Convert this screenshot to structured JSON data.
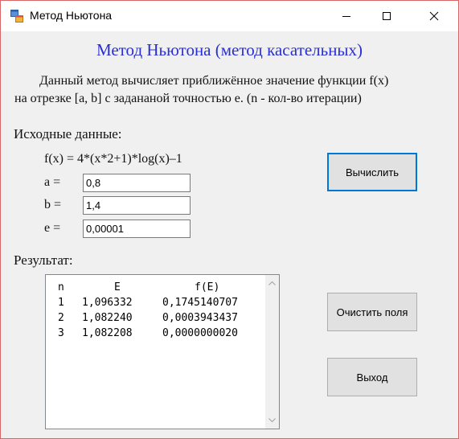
{
  "window": {
    "title": "Метод Ньютона",
    "minimize_glyph": "—",
    "maximize_glyph": "☐",
    "close_glyph": "✕"
  },
  "header": {
    "title": "Метод Ньютона (метод касательных)",
    "description_line1": "Данный метод вычисляет приближённое значение функции f(x)",
    "description_line2": "на отрезке [a, b] с задананой точностью e. (n - кол-во итерации)"
  },
  "inputs": {
    "section_label": "Исходные данные:",
    "formula": "f(x) = 4*(x*2+1)*log(x)–1",
    "a": {
      "label": "a =",
      "value": "0,8"
    },
    "b": {
      "label": "b =",
      "value": "1,4"
    },
    "e": {
      "label": "e =",
      "value": "0,00001"
    }
  },
  "result": {
    "section_label": "Результат:",
    "columns": [
      "n",
      "E",
      "f(E)"
    ],
    "rows": [
      [
        "1",
        "1,096332",
        "0,1745140707"
      ],
      [
        "2",
        "1,082240",
        "0,0003943437"
      ],
      [
        "3",
        "1,082208",
        "0,0000000020"
      ]
    ]
  },
  "buttons": {
    "compute": "Вычислить",
    "clear": "Очистить поля",
    "exit": "Выход"
  },
  "icons": {
    "app": "app-window-icon",
    "scroll_up": "chevron-up-icon",
    "scroll_down": "chevron-down-icon"
  },
  "colors": {
    "heading": "#2a2fd4",
    "focus_border": "#0078d7",
    "window_border": "#d96666"
  }
}
